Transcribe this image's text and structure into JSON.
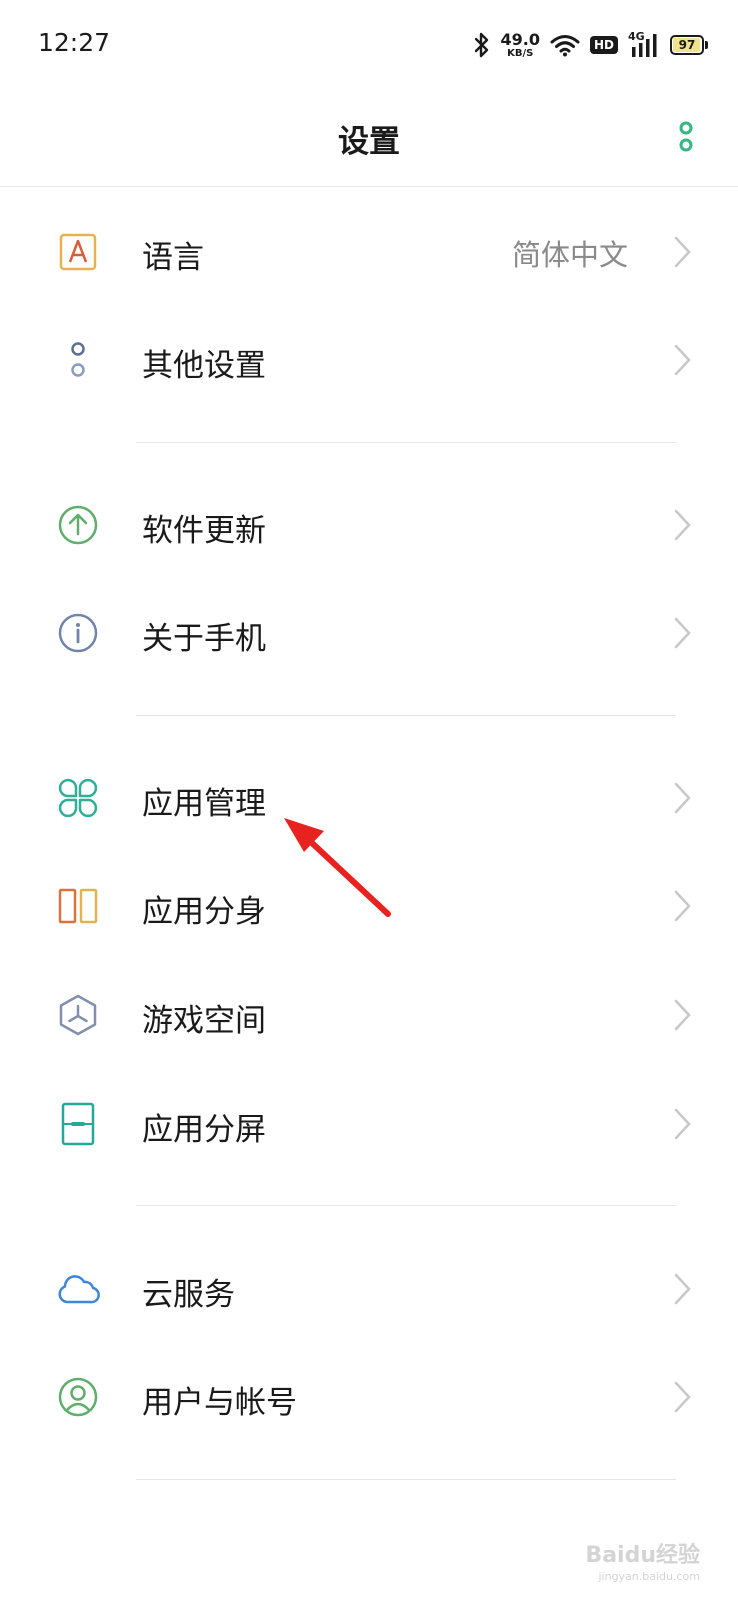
{
  "status_bar": {
    "time": "12:27",
    "net_speed_value": "49.0",
    "net_speed_unit": "KB/S",
    "hd_label": "HD",
    "signal_label": "4G",
    "battery_level": "97",
    "icons": [
      "bluetooth-icon",
      "wifi-icon",
      "hd-icon",
      "signal-icon",
      "battery-icon"
    ]
  },
  "header": {
    "title": "设置",
    "more_icon": "more-vertical-icon"
  },
  "items": [
    {
      "id": "language",
      "label": "语言",
      "value": "简体中文",
      "icon": "language-icon",
      "color": "#e0a23c"
    },
    {
      "id": "other-settings",
      "label": "其他设置",
      "icon": "more-settings-icon",
      "color": "#6b7fa8"
    },
    {
      "id": "software-update",
      "label": "软件更新",
      "icon": "update-icon",
      "color": "#5fae6a"
    },
    {
      "id": "about-phone",
      "label": "关于手机",
      "icon": "info-icon",
      "color": "#7284aa"
    },
    {
      "id": "app-management",
      "label": "应用管理",
      "icon": "apps-grid-icon",
      "color": "#2fae98"
    },
    {
      "id": "app-clone",
      "label": "应用分身",
      "icon": "app-clone-icon",
      "color": "#d8743c"
    },
    {
      "id": "game-space",
      "label": "游戏空间",
      "icon": "game-space-icon",
      "color": "#8290ad"
    },
    {
      "id": "split-screen",
      "label": "应用分屏",
      "icon": "split-screen-icon",
      "color": "#25a89a"
    },
    {
      "id": "cloud-service",
      "label": "云服务",
      "icon": "cloud-icon",
      "color": "#3d86d8"
    },
    {
      "id": "user-account",
      "label": "用户与帐号",
      "icon": "user-icon",
      "color": "#5fae6a"
    }
  ],
  "accent_color": "#33b980",
  "annotation_color": "#e8231f",
  "watermark": {
    "brand": "Baidu经验",
    "site": "jingyan.baidu.com"
  }
}
